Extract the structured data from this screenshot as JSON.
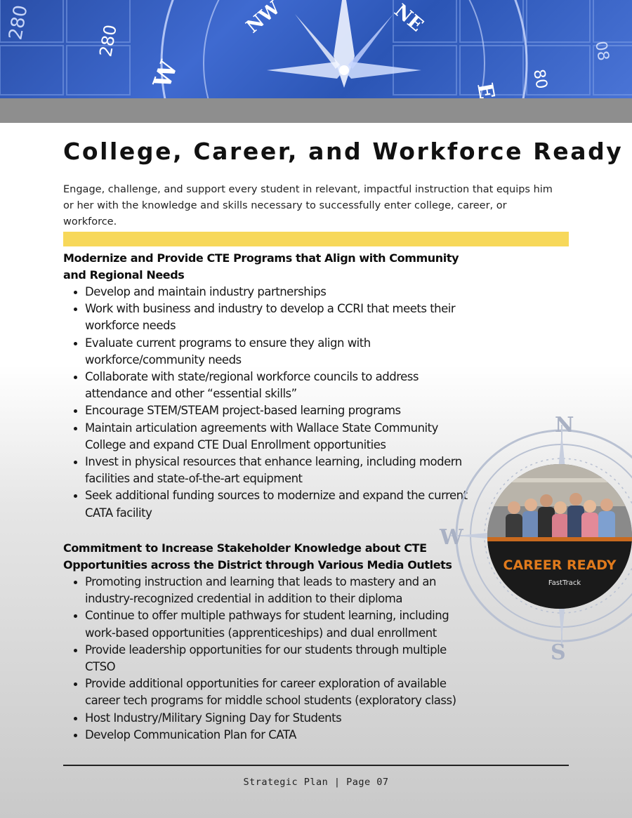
{
  "banner": {
    "scale_labels": [
      "280",
      "280",
      "80",
      "08"
    ],
    "direction_labels": [
      "W",
      "NW",
      "NE",
      "E"
    ]
  },
  "title": "College, Career, and Workforce Ready",
  "intro": "Engage, challenge, and support every student in relevant, impactful instruction that equips him or her with the knowledge and skills necessary to successfully enter college, career, or workforce.",
  "sections": [
    {
      "heading": "Modernize and Provide CTE Programs that Align with Community and Regional Needs",
      "items": [
        "Develop and maintain industry partnerships",
        "Work with business and industry to develop a CCRI that meets their workforce needs",
        "Evaluate current programs to ensure they align with workforce/community needs",
        "Collaborate with state/regional workforce councils to address attendance and other “essential skills”",
        "Encourage STEM/STEAM project-based learning programs",
        "Maintain articulation agreements with Wallace State Community College and expand CTE Dual Enrollment opportunities",
        "Invest in physical resources that enhance learning, including modern facilities and state-of-the-art equipment",
        "Seek additional funding sources to modernize and expand the current CATA facility"
      ]
    },
    {
      "heading": "Commitment to Increase Stakeholder Knowledge about CTE Opportunities across the District through Various Media Outlets",
      "items": [
        "Promoting instruction and learning that leads to mastery and an industry-recognized credential in addition to their diploma",
        "Continue to offer multiple pathways for student learning, including work-based opportunities (apprenticeships) and dual enrollment",
        "Provide leadership opportunities for our students through multiple CTSO",
        "Provide additional opportunities for career exploration of available career tech programs for middle school students (exploratory class)",
        "Host Industry/Military Signing Day for Students",
        "Develop Communication Plan for CATA"
      ]
    }
  ],
  "compass_letters": [
    "N",
    "W",
    "S"
  ],
  "photo": {
    "banner_text": "CAREER READY",
    "sub_text": "FastTrack"
  },
  "footer": "Strategic Plan | Page 07"
}
